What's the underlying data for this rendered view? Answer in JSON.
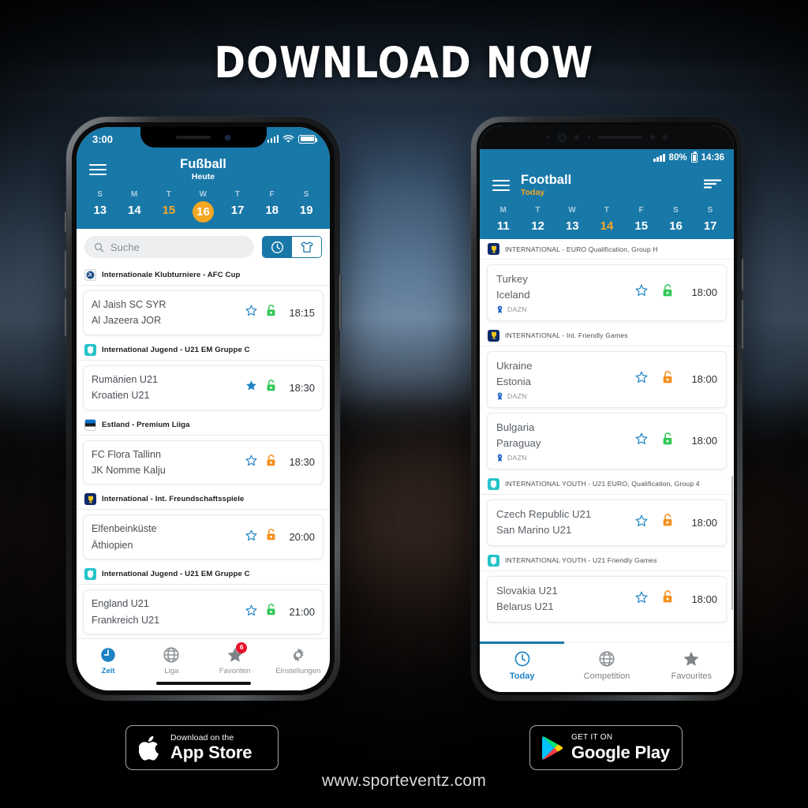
{
  "headline": "DOWNLOAD NOW",
  "website": "www.sporteventz.com",
  "colors": {
    "brand_blue": "#1878a8",
    "accent_orange": "#f5a623",
    "lock_green": "#34c759",
    "lock_orange": "#f5901e",
    "star_blue": "#1c82c4",
    "badge_red": "#e8112d",
    "tab_active": "#1c82c4"
  },
  "ios_phone": {
    "status": {
      "time": "3:00",
      "signal_icon": "signal-bars-icon",
      "wifi_icon": "wifi-icon",
      "battery_icon": "battery-icon"
    },
    "app_bar": {
      "menu_icon": "hamburger-menu-icon",
      "title": "Fußball",
      "subtitle": "Heute"
    },
    "days": [
      {
        "dow": "S",
        "num": "13",
        "state": "normal"
      },
      {
        "dow": "M",
        "num": "14",
        "state": "normal"
      },
      {
        "dow": "T",
        "num": "15",
        "state": "orange"
      },
      {
        "dow": "W",
        "num": "16",
        "state": "today"
      },
      {
        "dow": "T",
        "num": "17",
        "state": "normal"
      },
      {
        "dow": "F",
        "num": "18",
        "state": "normal"
      },
      {
        "dow": "S",
        "num": "19",
        "state": "normal"
      }
    ],
    "search": {
      "placeholder": "Suche",
      "icon": "search-icon"
    },
    "toggle": {
      "time_icon": "clock-icon",
      "team_icon": "shirt-icon",
      "selected": "time"
    },
    "sections": [
      {
        "league": "Internationale Klubturniere - AFC Cup",
        "badge": "afc-cup-logo",
        "matches": [
          {
            "home": "Al Jaish SC SYR",
            "away": "Al Jazeera JOR",
            "time": "18:15",
            "star": "outline",
            "lock": "green"
          }
        ]
      },
      {
        "league": "International Jugend - U21 EM Gruppe C",
        "badge": "uefa-u21-logo",
        "matches": [
          {
            "home": "Rumänien U21",
            "away": "Kroatien U21",
            "time": "18:30",
            "star": "filled",
            "lock": "green"
          }
        ]
      },
      {
        "league": "Estland - Premium Liiga",
        "badge": "estonia-flag",
        "matches": [
          {
            "home": "FC Flora Tallinn",
            "away": "JK Nomme Kalju",
            "time": "18:30",
            "star": "outline",
            "lock": "orange"
          }
        ]
      },
      {
        "league": "International - Int. Freundschaftsspiele",
        "badge": "trophy-logo",
        "matches": [
          {
            "home": "Elfenbeinküste",
            "away": "Äthiopien",
            "time": "20:00",
            "star": "outline",
            "lock": "orange"
          }
        ]
      },
      {
        "league": "International Jugend - U21 EM Gruppe C",
        "badge": "uefa-u21-logo",
        "matches": [
          {
            "home": "England U21",
            "away": "Frankreich U21",
            "time": "21:00",
            "star": "outline",
            "lock": "green"
          }
        ]
      }
    ],
    "tabs": [
      {
        "label": "Zeit",
        "icon": "clock-filled-icon",
        "active": true,
        "badge": ""
      },
      {
        "label": "Liga",
        "icon": "globe-icon",
        "active": false,
        "badge": ""
      },
      {
        "label": "Favoriten",
        "icon": "star-filled-icon",
        "active": false,
        "badge": "6"
      },
      {
        "label": "Einstellungen",
        "icon": "gear-icon",
        "active": false,
        "badge": ""
      }
    ]
  },
  "android_phone": {
    "status": {
      "signal_icon": "signal-bars-icon",
      "battery_pct": "80%",
      "battery_icon": "battery-icon",
      "time": "14:36"
    },
    "app_bar": {
      "menu_icon": "hamburger-menu-icon",
      "title": "Football",
      "subtitle": "Today",
      "filter_icon": "sort-filter-icon"
    },
    "days": [
      {
        "dow": "M",
        "num": "11",
        "state": "normal"
      },
      {
        "dow": "T",
        "num": "12",
        "state": "normal"
      },
      {
        "dow": "W",
        "num": "13",
        "state": "normal"
      },
      {
        "dow": "T",
        "num": "14",
        "state": "today"
      },
      {
        "dow": "F",
        "num": "15",
        "state": "normal"
      },
      {
        "dow": "S",
        "num": "16",
        "state": "normal"
      },
      {
        "dow": "S",
        "num": "17",
        "state": "normal"
      }
    ],
    "sections": [
      {
        "league": "INTERNATIONAL - EURO Qualification, Group H",
        "badge": "trophy-logo",
        "matches": [
          {
            "home": "Turkey",
            "away": "Iceland",
            "time": "18:00",
            "star": "outline",
            "lock": "green",
            "tv": "DAZN"
          }
        ]
      },
      {
        "league": "INTERNATIONAL - Int. Friendly Games",
        "badge": "trophy-logo",
        "matches": [
          {
            "home": "Ukraine",
            "away": "Estonia",
            "time": "18:00",
            "star": "outline",
            "lock": "orange",
            "tv": "DAZN"
          },
          {
            "home": "Bulgaria",
            "away": "Paraguay",
            "time": "18:00",
            "star": "outline",
            "lock": "green",
            "tv": "DAZN"
          }
        ]
      },
      {
        "league": "INTERNATIONAL YOUTH - U21 EURO, Qualification, Group 4",
        "badge": "uefa-u21-logo",
        "matches": [
          {
            "home": "Czech Republic U21",
            "away": "San Marino U21",
            "time": "18:00",
            "star": "outline",
            "lock": "orange",
            "tv": ""
          }
        ]
      },
      {
        "league": "INTERNATIONAL YOUTH - U21 Friendly Games",
        "badge": "uefa-u21-logo",
        "matches": [
          {
            "home": "Slovakia U21",
            "away": "Belarus U21",
            "time": "18:00",
            "star": "outline",
            "lock": "orange",
            "tv": ""
          }
        ]
      }
    ],
    "tabs": [
      {
        "label": "Today",
        "icon": "clock-outline-icon",
        "active": true
      },
      {
        "label": "Competition",
        "icon": "globe-icon",
        "active": false
      },
      {
        "label": "Favourites",
        "icon": "star-filled-icon",
        "active": false
      }
    ]
  },
  "app_store_badge": {
    "icon": "apple-logo-icon",
    "small": "Download on the",
    "big": "App Store"
  },
  "google_play_badge": {
    "icon": "google-play-logo-icon",
    "small": "GET IT ON",
    "big": "Google Play"
  }
}
